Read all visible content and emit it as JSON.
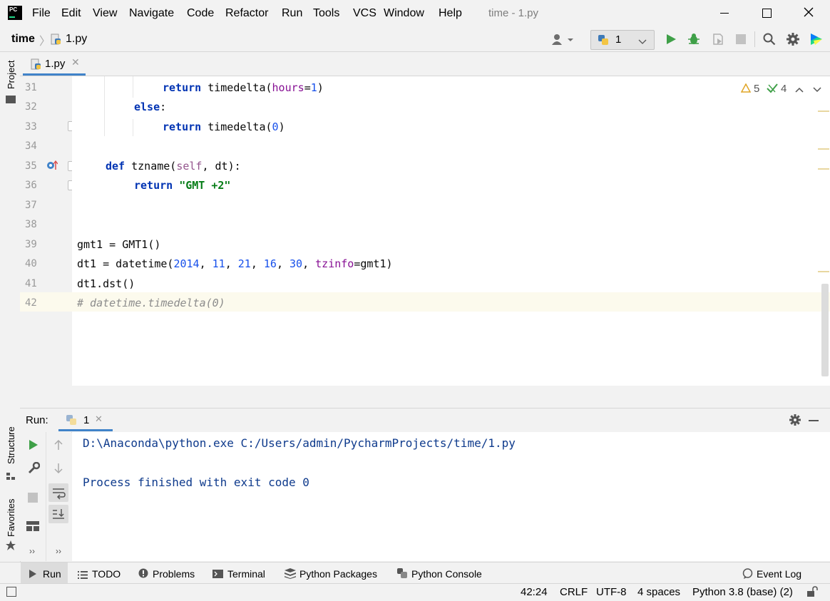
{
  "window": {
    "title": "time - 1.py",
    "menu": [
      "File",
      "Edit",
      "View",
      "Navigate",
      "Code",
      "Refactor",
      "Run",
      "Tools",
      "VCS",
      "Window",
      "Help"
    ]
  },
  "navbar": {
    "project": "time",
    "file": "1.py",
    "run_config": "1"
  },
  "editor": {
    "tab": "1.py",
    "warnings": "5",
    "checks": "4",
    "lines": [
      {
        "n": "31"
      },
      {
        "n": "32"
      },
      {
        "n": "33"
      },
      {
        "n": "34"
      },
      {
        "n": "35"
      },
      {
        "n": "36"
      },
      {
        "n": "37"
      },
      {
        "n": "38"
      },
      {
        "n": "39"
      },
      {
        "n": "40"
      },
      {
        "n": "41"
      },
      {
        "n": "42"
      }
    ]
  },
  "side": {
    "project": "Project",
    "structure": "Structure",
    "favorites": "Favorites"
  },
  "run": {
    "label": "Run:",
    "tab": "1",
    "output": [
      "D:\\Anaconda\\python.exe C:/Users/admin/PycharmProjects/time/1.py",
      "Process finished with exit code 0"
    ]
  },
  "bottom": {
    "run": "Run",
    "todo": "TODO",
    "problems": "Problems",
    "terminal": "Terminal",
    "packages": "Python Packages",
    "console": "Python Console",
    "eventlog": "Event Log"
  },
  "status": {
    "position": "42:24",
    "line_sep": "CRLF",
    "encoding": "UTF-8",
    "indent": "4 spaces",
    "interpreter": "Python 3.8 (base) (2)"
  },
  "colors": {
    "keyword": "#0033b3",
    "string": "#067d17",
    "number": "#1750eb",
    "console_text": "#0e3a8c",
    "current_line": "#fcfaed"
  }
}
